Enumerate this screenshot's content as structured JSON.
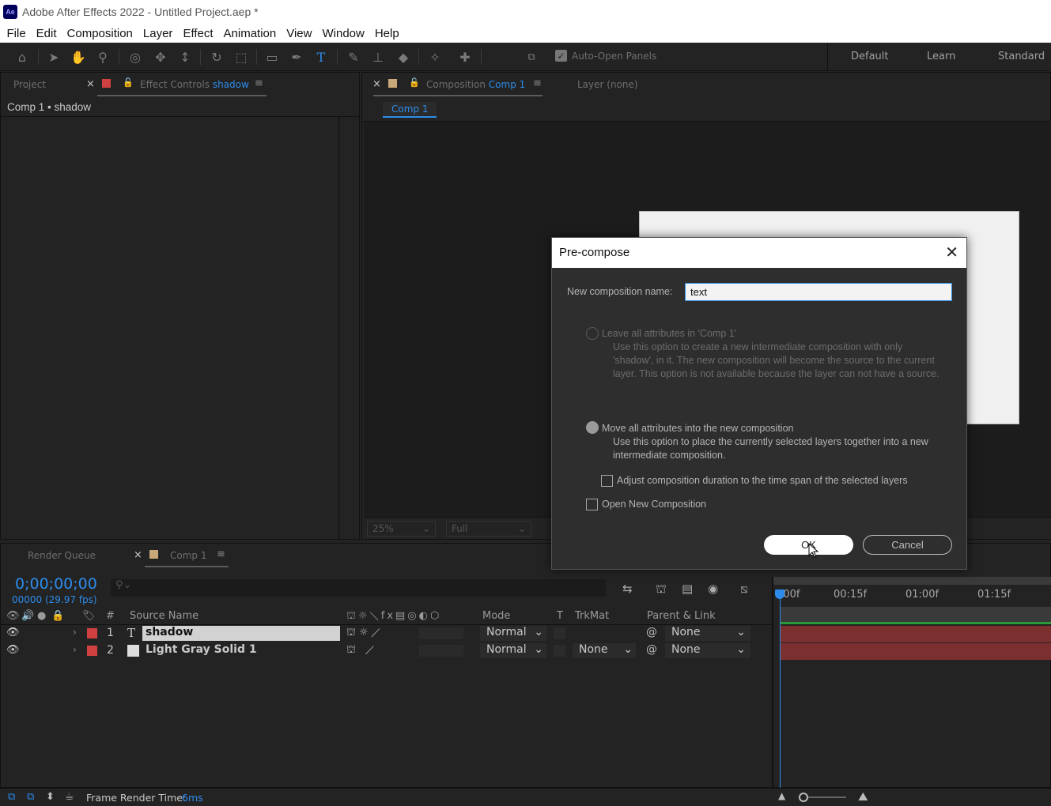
{
  "window": {
    "title": "Adobe After Effects 2022 - Untitled Project.aep *",
    "logo": "Ae"
  },
  "menu": [
    "File",
    "Edit",
    "Composition",
    "Layer",
    "Effect",
    "Animation",
    "View",
    "Window",
    "Help"
  ],
  "toolbar": {
    "auto_open_label": "Auto-Open Panels",
    "workspaces": [
      "Default",
      "Learn",
      "Standard"
    ],
    "icons": [
      "home-icon",
      "selection-tool-icon",
      "hand-tool-icon",
      "zoom-tool-icon",
      "orbit-camera-icon",
      "pan-camera-icon",
      "dolly-camera-icon",
      "rotate-tool-icon",
      "pan-behind-icon",
      "rectangle-tool-icon",
      "pen-tool-icon",
      "type-tool-icon",
      "brush-tool-icon",
      "clone-stamp-icon",
      "eraser-icon",
      "roto-brush-icon",
      "puppet-pin-icon"
    ]
  },
  "left_panel": {
    "tab_project": "Project",
    "tab_effect_controls": "Effect Controls",
    "tab_effect_target": "shadow",
    "breadcrumb": "Comp 1 • shadow"
  },
  "comp_panel": {
    "tab_composition": "Composition",
    "tab_comp_name": "Comp 1",
    "tab_layer": "Layer (none)",
    "sub_tab": "Comp 1",
    "zoom": "25%",
    "resolution": "Full"
  },
  "timeline": {
    "tab_render_queue": "Render Queue",
    "tab_comp": "Comp 1",
    "timecode": "0;00;00;00",
    "fps": "00000 (29.97 fps)",
    "columns": {
      "hash": "#",
      "source_name": "Source Name",
      "mode": "Mode",
      "t": "T",
      "trkmat": "TrkMat",
      "parent": "Parent & Link"
    },
    "ruler_labels": [
      ":00f",
      "00:15f",
      "01:00f",
      "01:15f"
    ],
    "layers": [
      {
        "num": "1",
        "name": "shadow",
        "mode": "Normal",
        "trkmat": "",
        "parent": "None",
        "color": "#d04040",
        "type": "T"
      },
      {
        "num": "2",
        "name": "Light Gray Solid 1",
        "mode": "Normal",
        "trkmat": "None",
        "parent": "None",
        "color": "#d04040",
        "type": "solid"
      }
    ],
    "status": "Frame Render Time:",
    "render_time": "6ms"
  },
  "dialog": {
    "title": "Pre-compose",
    "name_label": "New composition name:",
    "name_value": "text",
    "option1_label": "Leave all attributes in 'Comp 1'",
    "option1_desc": "Use this option to create a new intermediate composition with only 'shadow', in it. The new composition will become the source to the current layer. This option is not available because the layer can not have a source.",
    "option2_label": "Move all attributes into the new composition",
    "option2_desc": "Use this option to place the currently selected layers together into a new intermediate composition.",
    "adjust_label": "Adjust composition duration to the time span of the selected layers",
    "open_new_label": "Open New Composition",
    "ok_label": "OK",
    "cancel_label": "Cancel"
  },
  "colors": {
    "accent": "#2d8ceb",
    "label_red": "#d04040",
    "swatch_tan": "#c8a878",
    "track_red": "#7c2f2f"
  }
}
